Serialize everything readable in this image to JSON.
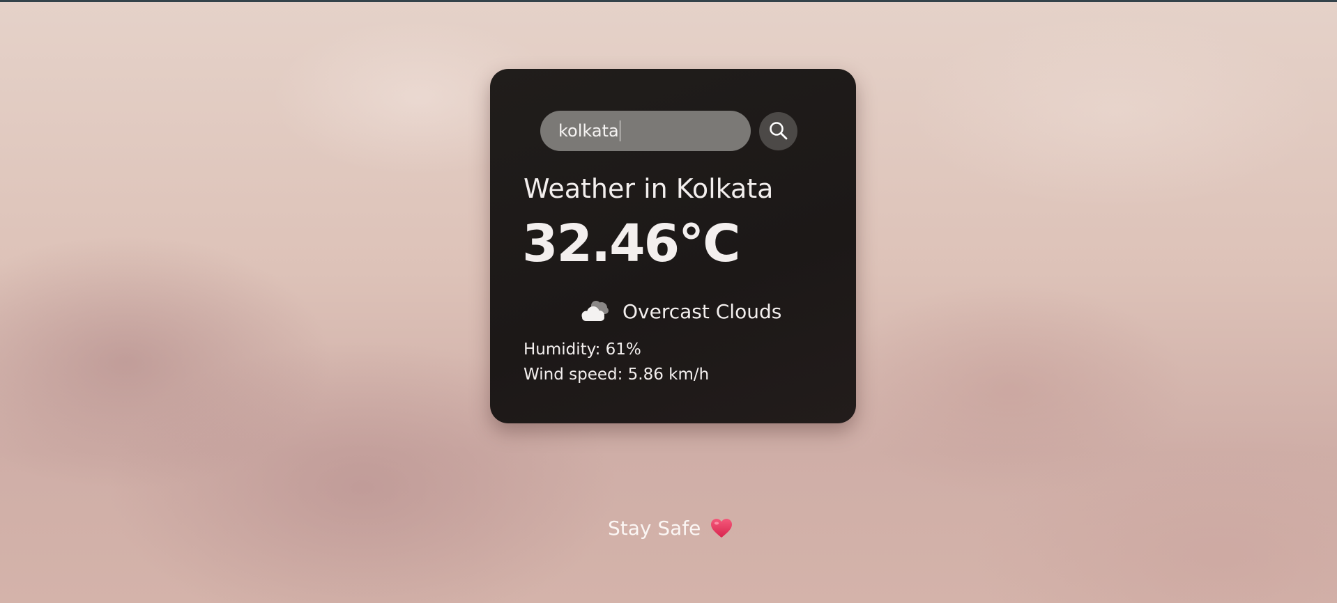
{
  "search": {
    "value": "kolkata",
    "icon": "search-icon"
  },
  "weather": {
    "title": "Weather in Kolkata",
    "temperature": "32.46°C",
    "condition_icon": "cloud-icon",
    "condition": "Overcast Clouds",
    "humidity": "Humidity: 61%",
    "wind_speed": "Wind speed: 5.86 km/h"
  },
  "footer": {
    "text": "Stay Safe",
    "icon": "heart-icon"
  },
  "colors": {
    "card_background": "#1e1a19",
    "search_field": "#7b7976",
    "search_button": "#4c4947",
    "text": "#f3efee",
    "heart": "#e8365f"
  }
}
